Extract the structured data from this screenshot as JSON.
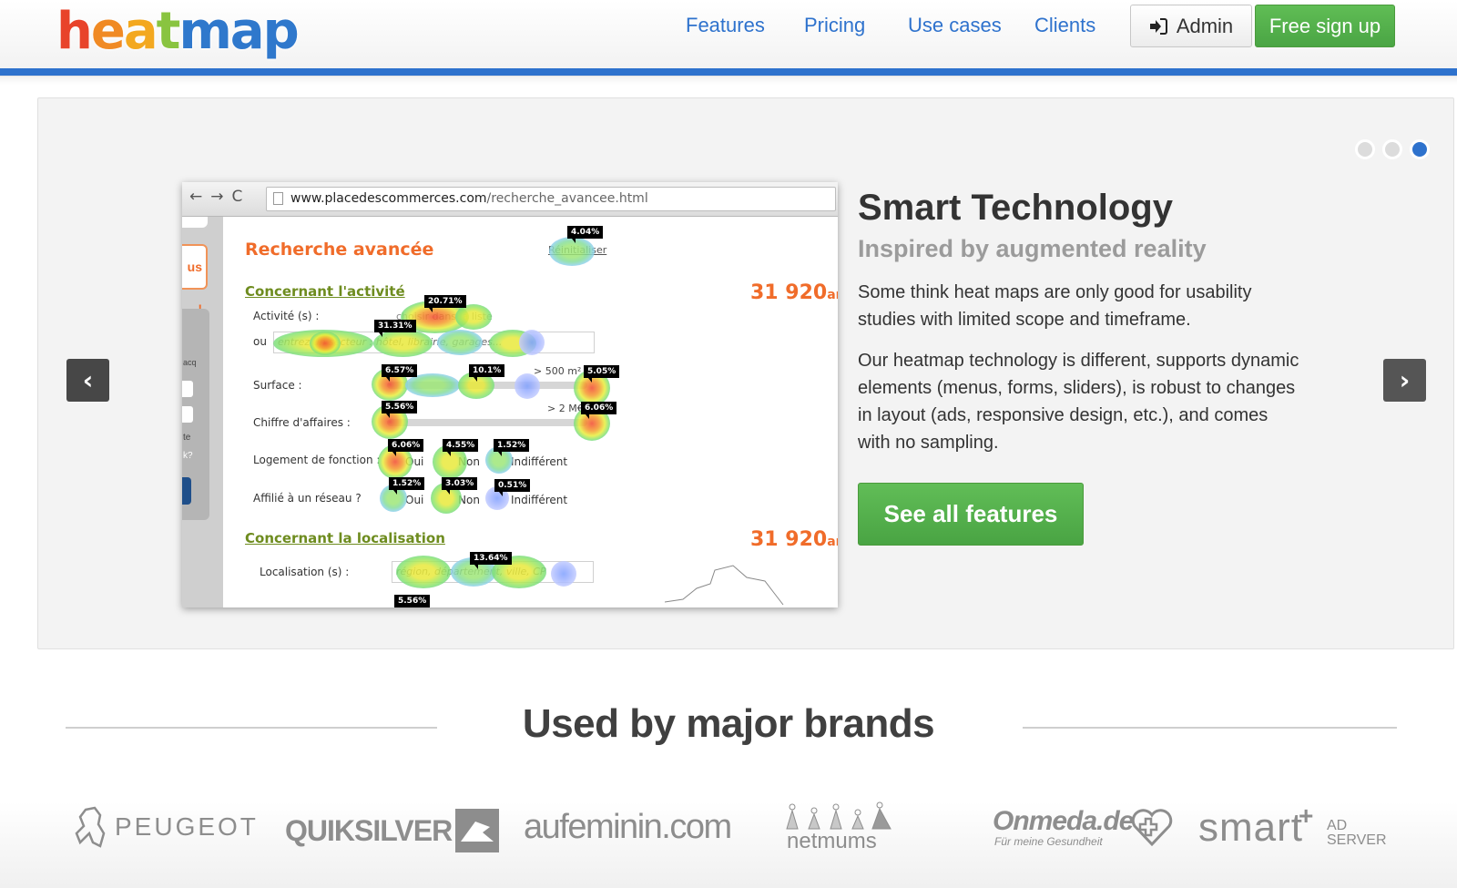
{
  "header": {
    "logo": {
      "letters": [
        "h",
        "e",
        "a",
        "t",
        "map"
      ],
      "text": "heatmap"
    },
    "nav": [
      "Features",
      "Pricing",
      "Use cases",
      "Clients"
    ],
    "admin_label": "Admin",
    "signup_label": "Free sign up",
    "accent_color": "#2e72cd"
  },
  "carousel": {
    "dots": {
      "count": 3,
      "active_index": 2
    },
    "prev_label": "‹",
    "next_label": "›",
    "slide": {
      "title": "Smart Technology",
      "subtitle": "Inspired by augmented reality",
      "paragraphs": [
        "Some think heat maps are only good for usability studies with limited scope and timeframe.",
        "Our heatmap technology is different, supports dynamic elements (menus, forms, sliders), is robust to changes in layout (ads, responsive design, etc.), and comes with no sampling."
      ],
      "cta_label": "See all features"
    },
    "mockup": {
      "url_domain": "www.placedescommerces.com",
      "url_path": "/recherche_avancee.html",
      "nav_icons": [
        "←",
        "→",
        "C"
      ],
      "sidebar_button_text": "us !",
      "sidebar_texts": [
        "acq",
        "te",
        "k?"
      ],
      "page_title": "Recherche avancée",
      "reset_link": "Réinitialiser",
      "section1": "Concernant l'activité",
      "section2": "Concernant la localisation",
      "result_count": "31 920",
      "result_count_suffix": "ar",
      "labels": {
        "activite": "Activité (s) :",
        "ou": "ou",
        "surface": "Surface :",
        "chiffre": "Chiffre d'affaires :",
        "logement": "Logement de fonction :",
        "affilie": "Affilié à un réseau ?",
        "localisation": "Localisation (s) :"
      },
      "activite_select": "choisir dans la liste",
      "ou_placeholder": "entrez un secteur : hôtel, librairie, garages...",
      "localisation_placeholder": "région, département, ville, CP",
      "surface_max": "> 500 m²",
      "chiffre_max": "> 2 M€",
      "options": [
        "Oui",
        "Non",
        "Indifférent"
      ],
      "percentages": {
        "reset": "4.04%",
        "activite": "20.71%",
        "ou": "31.31%",
        "surface_min": "6.57%",
        "surface_mid": "10.1%",
        "surface_max": "5.05%",
        "chiffre_min": "5.56%",
        "chiffre_max": "6.06%",
        "logement_oui": "6.06%",
        "logement_non": "4.55%",
        "logement_indiff": "1.52%",
        "affilie_oui": "1.52%",
        "affilie_non": "3.03%",
        "affilie_indiff": "0.51%",
        "localisation": "13.64%",
        "bottom": "5.56%"
      }
    }
  },
  "brands": {
    "title": "Used by major brands",
    "logos": [
      "PEUGEOT",
      "QUIKSILVER",
      "aufeminin.com",
      "netmums",
      "Onmeda.de",
      "Für meine Gesundheit",
      "smart",
      "AD",
      "SERVER"
    ]
  }
}
